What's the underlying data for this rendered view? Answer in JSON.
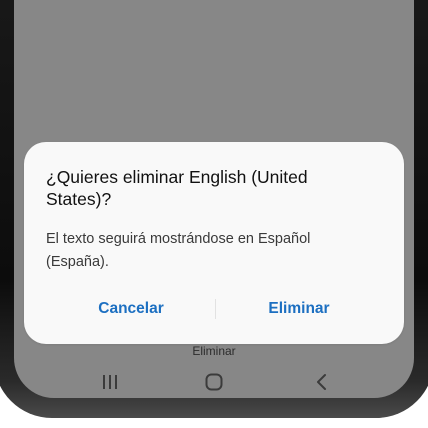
{
  "dialog": {
    "title": "¿Quieres eliminar English (United States)?",
    "message": "El texto seguirá mostrándose en Español (España).",
    "cancel_label": "Cancelar",
    "confirm_label": "Eliminar"
  },
  "background": {
    "button_label": "Eliminar"
  },
  "nav_bar": {
    "icons": [
      "recent-apps-icon",
      "home-icon",
      "back-icon"
    ]
  },
  "colors": {
    "accent": "#1c6fc1",
    "dialog_bg": "#f9f9f9",
    "scrim": "#878787",
    "title_text": "#111111",
    "body_text": "#3a3a3a"
  }
}
